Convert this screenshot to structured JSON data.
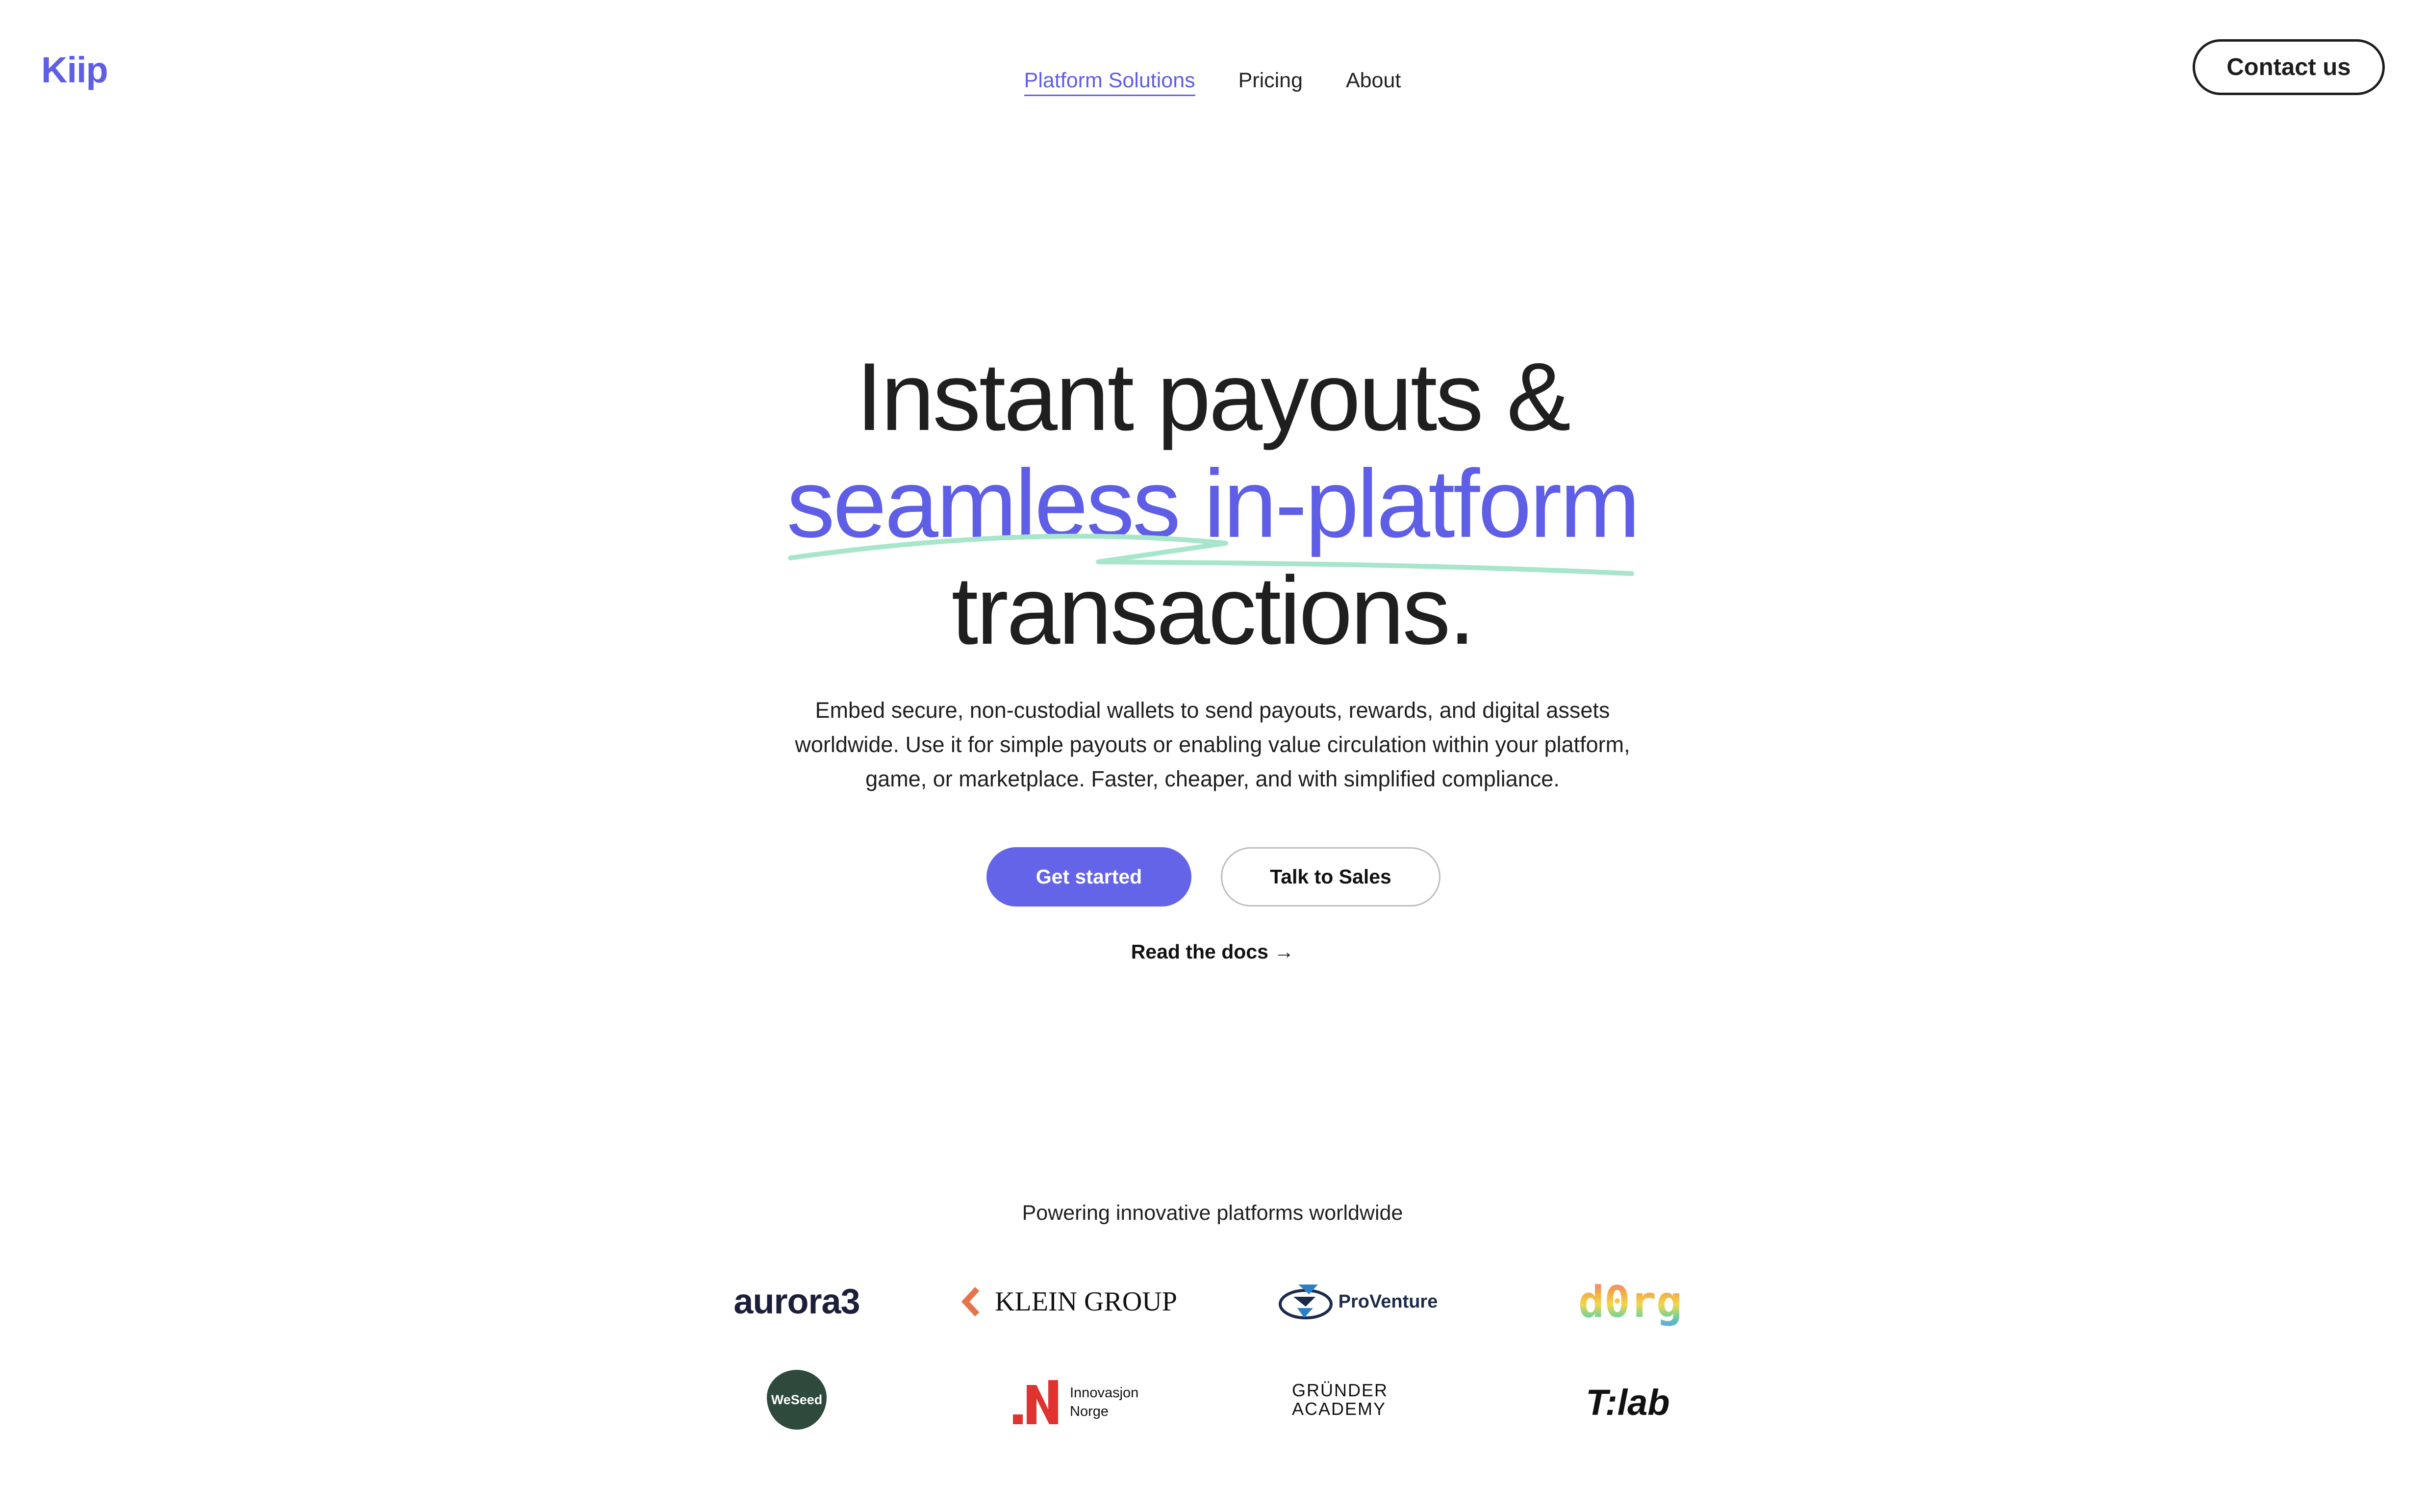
{
  "brand": {
    "name": "Kiip",
    "accent": "#5f5ee6",
    "highlight": "#a8e6cc"
  },
  "nav": {
    "items": [
      {
        "label": "Platform Solutions",
        "active": true
      },
      {
        "label": "Pricing",
        "active": false
      },
      {
        "label": "About",
        "active": false
      }
    ],
    "contact_label": "Contact us"
  },
  "hero": {
    "line1": "Instant payouts &",
    "line2": "seamless in-platform",
    "line3": "transactions.",
    "description": "Embed secure, non-custodial wallets to send payouts, rewards, and digital assets worldwide. Use it for simple payouts or enabling value circulation within your platform, game, or marketplace. Faster, cheaper, and with simplified compliance.",
    "primary_cta": "Get started",
    "secondary_cta": "Talk to Sales",
    "docs_link": "Read the docs →"
  },
  "partners": {
    "heading": "Powering innovative platforms worldwide",
    "logos": [
      {
        "name": "aurora3",
        "icon": "aurora3-logo"
      },
      {
        "name": "KLEIN GROUP",
        "icon": "klein-group-logo"
      },
      {
        "name": "ProVenture",
        "icon": "proventure-logo"
      },
      {
        "name": "d0rg",
        "icon": "d0rg-logo"
      },
      {
        "name": "WeSeed",
        "icon": "weseed-logo"
      },
      {
        "name": "Innovasjon Norge",
        "icon": "innovasjon-norge-logo"
      },
      {
        "name": "GRÜNDER ACADEMY",
        "icon": "grunder-academy-logo"
      },
      {
        "name": "T:lab",
        "icon": "tlab-logo"
      }
    ]
  }
}
